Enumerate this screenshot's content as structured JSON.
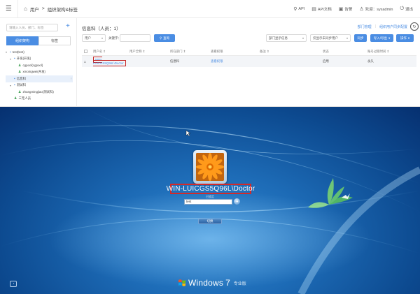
{
  "topbar": {
    "breadcrumb": [
      "用户",
      "组织架构&标签"
    ],
    "actions": [
      {
        "icon": "link-icon",
        "label": "API"
      },
      {
        "icon": "doc-icon",
        "label": "API文档"
      },
      {
        "icon": "alert-icon",
        "label": "告警"
      },
      {
        "icon": "user-icon",
        "label": "欢迎：sysadmin"
      },
      {
        "icon": "power-icon",
        "label": "退出"
      }
    ]
  },
  "sidebar": {
    "search_placeholder": "请输入人员、部门、标签",
    "tabs": [
      "组织架构",
      "标签"
    ],
    "active_tab": 0,
    "tree": [
      {
        "label": "test(test)",
        "type": "org",
        "level": 0,
        "caret": "▾"
      },
      {
        "label": "开发(开发)",
        "type": "org",
        "level": 1,
        "caret": "▾"
      },
      {
        "label": "cgpool(cgpool)",
        "type": "user",
        "level": 2,
        "caret": ""
      },
      {
        "label": "xmoingwei(开发)",
        "type": "user",
        "level": 2,
        "caret": ""
      },
      {
        "label": "信息科",
        "type": "org",
        "level": 1,
        "caret": "",
        "selected": true
      },
      {
        "label": "测试科",
        "type": "org",
        "level": 1,
        "caret": "▾"
      },
      {
        "label": "zhangmingjiao(测试科)",
        "type": "user",
        "level": 2,
        "caret": ""
      },
      {
        "label": "三无人员",
        "type": "user",
        "level": 1,
        "caret": ""
      }
    ]
  },
  "main": {
    "title": "信息科（人员：1）",
    "links": [
      "部门管理",
      "组织用户同步配置"
    ],
    "filter": {
      "type_value": "用户",
      "keyword_label": "关键字：",
      "search_button": "查询",
      "dept_select": "部门显示信息",
      "sync_select": "仅显示未同步用户",
      "sync_button": "同步",
      "import_button": "导入/导出",
      "ops_button": "操作"
    },
    "columns": [
      "用户名 ⇕",
      "用户全称 ⇕",
      "所在部门 ⇕",
      "查看权限",
      "备注 ⇕",
      "状态",
      "账号过期时间 ⇕"
    ],
    "rows": [
      {
        "index": "1",
        "username": "WIN-LUICGS5Q96L\\Doctor",
        "fullname": "",
        "department": "信息科",
        "perm": "查看权限",
        "remark": "",
        "status": "启用",
        "expire": "永久"
      }
    ]
  },
  "logon": {
    "username": "WIN-LUICGS5Q96L\\Doctor",
    "sub_label": "已锁定",
    "password_value": "test",
    "switch_user": "切换",
    "brand_name": "Windows",
    "brand_version": "7",
    "brand_edition": "专业版"
  }
}
